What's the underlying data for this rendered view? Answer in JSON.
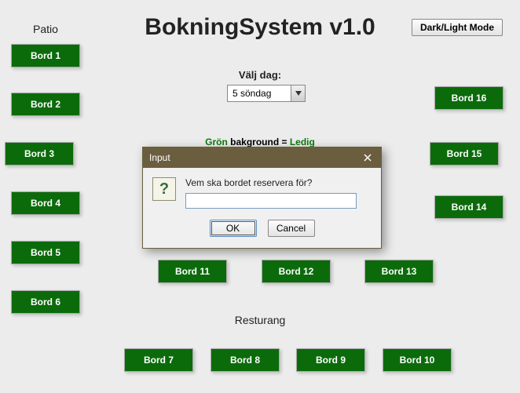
{
  "title": "BokningSystem v1.0",
  "dark_light": "Dark/Light Mode",
  "sections": {
    "patio": "Patio",
    "resturang": "Resturang"
  },
  "day": {
    "label": "Välj dag:",
    "value": "5 söndag"
  },
  "legend": {
    "g1": "Grön ",
    "g2": "bakground = ",
    "g3": "Ledig"
  },
  "tables": {
    "b1": "Bord 1",
    "b2": "Bord 2",
    "b3": "Bord 3",
    "b4": "Bord 4",
    "b5": "Bord 5",
    "b6": "Bord 6",
    "b7": "Bord 7",
    "b8": "Bord 8",
    "b9": "Bord 9",
    "b10": "Bord 10",
    "b11": "Bord 11",
    "b12": "Bord 12",
    "b13": "Bord 13",
    "b14": "Bord 14",
    "b15": "Bord 15",
    "b16": "Bord 16"
  },
  "dialog": {
    "title": "Input",
    "question_icon": "?",
    "prompt": "Vem ska bordet reservera för?",
    "input_value": "",
    "ok": "OK",
    "cancel": "Cancel"
  }
}
